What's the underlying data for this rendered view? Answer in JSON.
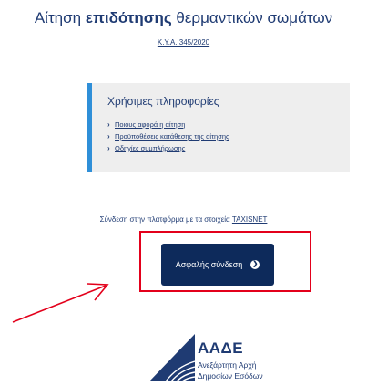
{
  "header": {
    "title_part1": "Αίτηση ",
    "title_bold": "επιδότησης",
    "title_part2": " θερμαντικών σωμάτων",
    "subtitle_link": "Κ.Υ.Α. 345/2020"
  },
  "info": {
    "title": "Χρήσιμες πληροφορίες",
    "links": [
      "Ποιους αφορά η αίτηση",
      "Προϋποθέσεις κατάθεσης της αίτησης",
      "Οδηγίες συμπλήρωσης"
    ]
  },
  "login": {
    "label_prefix": "Σύνδεση στην πλατφόρμα με τα στοιχεία ",
    "label_link": "TAXISNET",
    "button_label": "Ασφαλής σύνδεση",
    "button_icon": "chevron-right-circle-icon"
  },
  "annotation": {
    "color": "#e3001b"
  },
  "logo": {
    "abbr": "ΑΑΔΕ",
    "line1": "Ανεξάρτητη Αρχή",
    "line2": "Δημοσίων Εσόδων"
  },
  "colors": {
    "brand_navy": "#0d2a5b",
    "text_blue": "#1f3b73",
    "accent_bar": "#2f8fd8",
    "info_bg": "#eeeeee"
  }
}
